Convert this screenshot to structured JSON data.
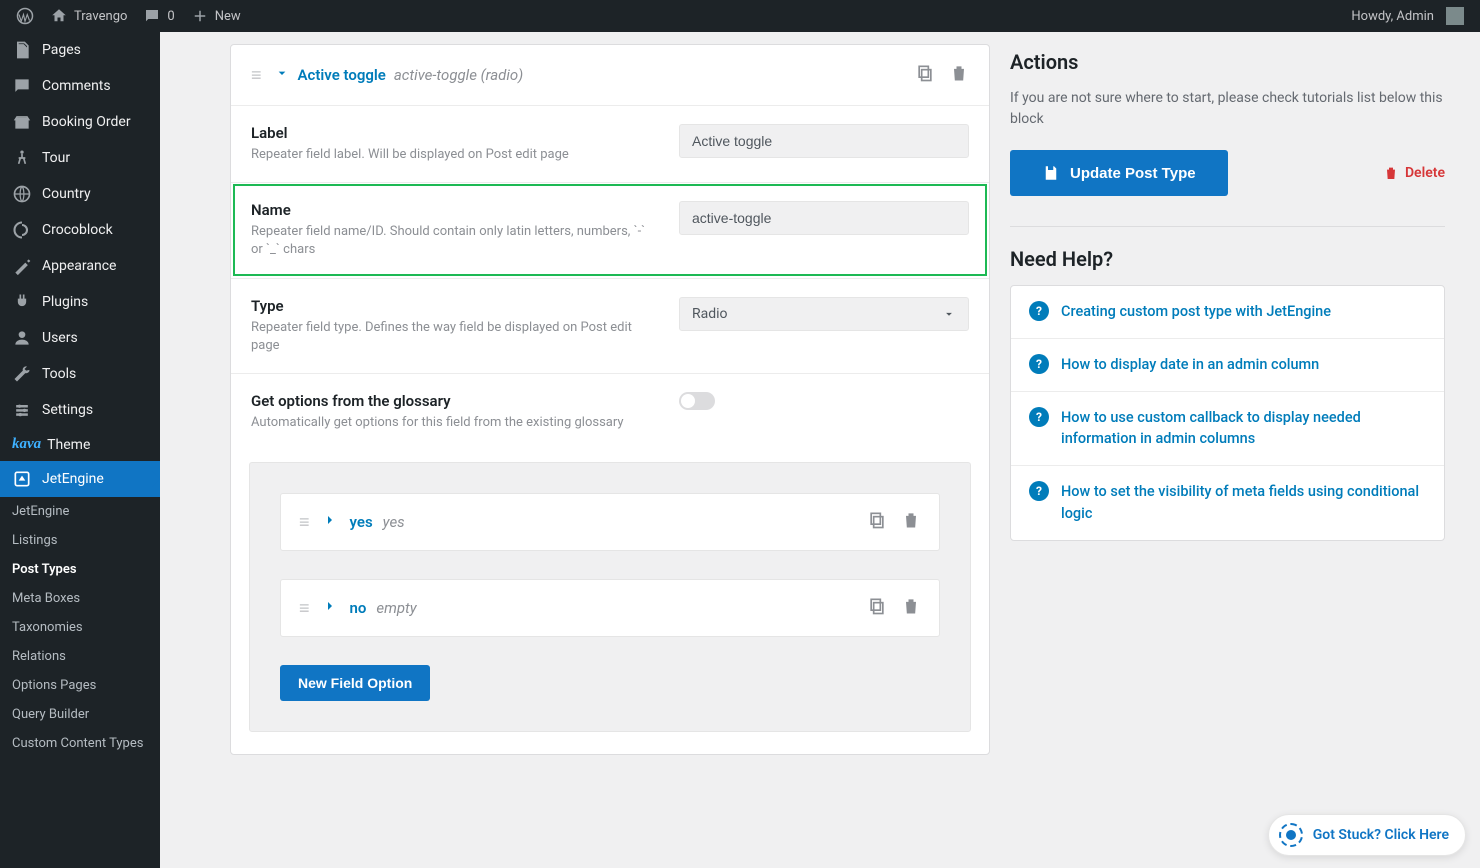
{
  "topbar": {
    "site_name": "Travengo",
    "comments_count": "0",
    "new_label": "New",
    "greeting": "Howdy, Admin"
  },
  "sidebar": {
    "items": [
      {
        "label": "Pages"
      },
      {
        "label": "Comments"
      },
      {
        "label": "Booking Order"
      },
      {
        "label": "Tour"
      },
      {
        "label": "Country"
      },
      {
        "label": "Crocoblock"
      },
      {
        "label": "Appearance"
      },
      {
        "label": "Plugins"
      },
      {
        "label": "Users"
      },
      {
        "label": "Tools"
      },
      {
        "label": "Settings"
      }
    ],
    "kava_label": "Theme",
    "jetengine_label": "JetEngine",
    "subs": [
      "JetEngine",
      "Listings",
      "Post Types",
      "Meta Boxes",
      "Taxonomies",
      "Relations",
      "Options Pages",
      "Query Builder",
      "Custom Content Types"
    ]
  },
  "editor": {
    "header_title": "Active toggle",
    "header_sub": "active-toggle (radio)",
    "fields": {
      "label": {
        "title": "Label",
        "desc": "Repeater field label. Will be displayed on Post edit page",
        "value": "Active toggle"
      },
      "name": {
        "title": "Name",
        "desc": "Repeater field name/ID. Should contain only latin letters, numbers, `-` or `_` chars",
        "value": "active-toggle"
      },
      "type": {
        "title": "Type",
        "desc": "Repeater field type. Defines the way field be displayed on Post edit page",
        "value": "Radio"
      },
      "glossary": {
        "title": "Get options from the glossary",
        "desc": "Automatically get options for this field from the existing glossary"
      }
    },
    "options": [
      {
        "label": "yes",
        "value": "yes"
      },
      {
        "label": "no",
        "value": "empty"
      }
    ],
    "new_option_btn": "New Field Option"
  },
  "aside": {
    "actions_title": "Actions",
    "actions_desc": "If you are not sure where to start, please check tutorials list below this block",
    "update_btn": "Update Post Type",
    "delete_btn": "Delete",
    "help_title": "Need Help?",
    "help_items": [
      "Creating custom post type with JetEngine",
      "How to display date in an admin column",
      "How to use custom callback to display needed information in admin columns",
      "How to set the visibility of meta fields using conditional logic"
    ]
  },
  "stuck": "Got Stuck? Click Here"
}
